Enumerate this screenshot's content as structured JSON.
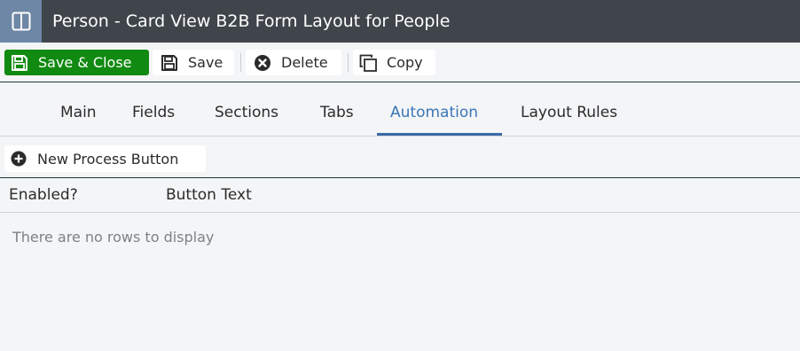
{
  "window": {
    "title": "Person - Card View B2B Form Layout for People",
    "app_icon": "panel-layout-icon"
  },
  "toolbar": {
    "save_close_label": "Save & Close",
    "save_label": "Save",
    "delete_label": "Delete",
    "copy_label": "Copy"
  },
  "tabs": [
    {
      "label": "Main"
    },
    {
      "label": "Fields"
    },
    {
      "label": "Sections"
    },
    {
      "label": "Tabs"
    },
    {
      "label": "Automation",
      "active": true
    },
    {
      "label": "Layout Rules"
    }
  ],
  "automation": {
    "new_button_label": "New Process Button",
    "columns": [
      "Enabled?",
      "Button Text"
    ],
    "empty_message": "There are no rows to display"
  },
  "colors": {
    "titlebar": "#40454c",
    "app_icon_bg": "#6f87a6",
    "primary": "#108a10",
    "active_tab": "#3a76b5"
  }
}
